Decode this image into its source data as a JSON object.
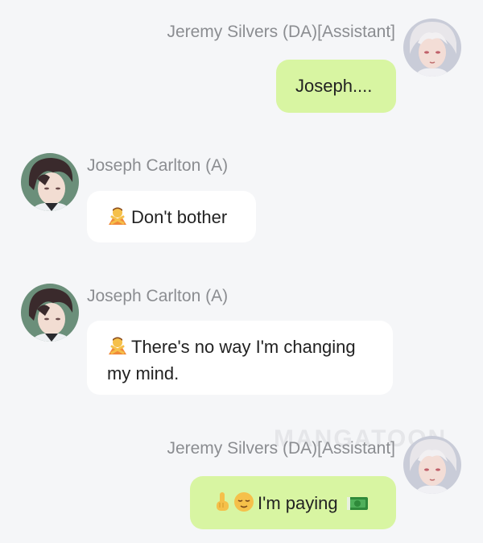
{
  "messages": [
    {
      "sender": "Jeremy Silvers (DA)[Assistant]",
      "side": "right",
      "avatar_icon": "silver-hair-avatar",
      "text": "Joseph...."
    },
    {
      "sender": "Joseph Carlton (A)",
      "side": "left",
      "avatar_icon": "dark-hair-avatar",
      "emoji": "person-gesturing-no-emoji",
      "text": "Don't bother"
    },
    {
      "sender": "Joseph Carlton (A)",
      "side": "left",
      "avatar_icon": "dark-hair-avatar",
      "emoji": "person-gesturing-no-emoji",
      "text_line1": "There's no way I'm changing",
      "text_line2": "my mind."
    },
    {
      "sender": "Jeremy Silvers (DA)[Assistant]",
      "side": "right",
      "avatar_icon": "silver-hair-avatar",
      "emojis": [
        "pointing-up-emoji",
        "relieved-face-emoji",
        "dollar-banknote-emoji"
      ],
      "text": "I'm paying"
    }
  ],
  "watermark": "MANGATOON",
  "colors": {
    "background": "#f5f6f8",
    "outgoing_bubble": "#d8f5a2",
    "incoming_bubble": "#ffffff",
    "name_text": "#8b8d91"
  }
}
